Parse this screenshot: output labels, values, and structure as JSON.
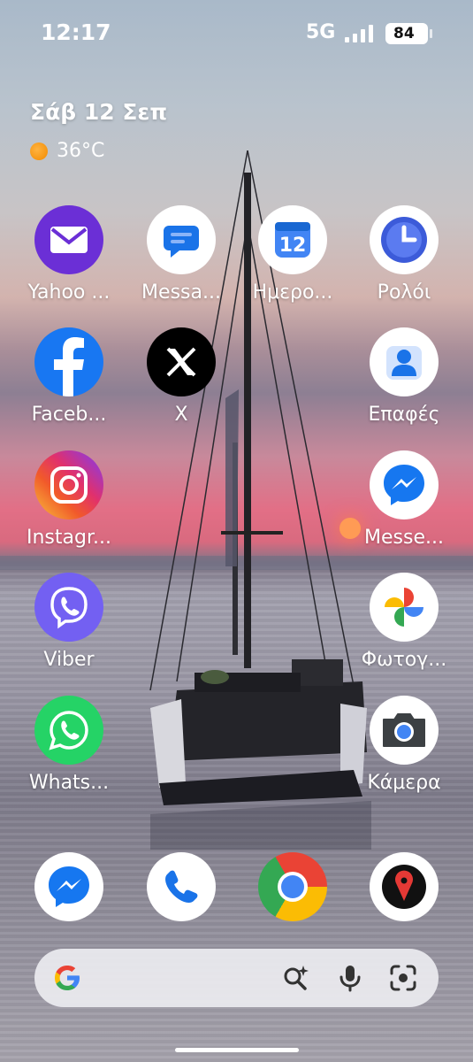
{
  "status": {
    "time": "12:17",
    "network": "5G",
    "battery": "84"
  },
  "widget": {
    "date": "Σάβ 12 Σεπ",
    "temperature": "36°C"
  },
  "apps": [
    {
      "label": "Yahoo ...",
      "icon": "yahoo-mail-icon"
    },
    {
      "label": "Messa...",
      "icon": "messages-icon"
    },
    {
      "label": "Ημερο...",
      "icon": "calendar-icon",
      "day": "12"
    },
    {
      "label": "Ρολόι",
      "icon": "clock-icon"
    },
    {
      "label": "Faceb...",
      "icon": "facebook-icon"
    },
    {
      "label": "X",
      "icon": "x-icon"
    },
    {
      "label": "Επαφές",
      "icon": "contacts-icon"
    },
    {
      "label": "Instagr...",
      "icon": "instagram-icon"
    },
    {
      "label": "Messe...",
      "icon": "messenger-icon"
    },
    {
      "label": "Viber",
      "icon": "viber-icon"
    },
    {
      "label": "Φωτογ...",
      "icon": "photos-icon"
    },
    {
      "label": "Whats...",
      "icon": "whatsapp-icon"
    },
    {
      "label": "Κάμερα",
      "icon": "camera-icon"
    }
  ],
  "dock": [
    {
      "icon": "messenger-icon"
    },
    {
      "icon": "phone-icon"
    },
    {
      "icon": "chrome-icon"
    },
    {
      "icon": "maps-pin-icon"
    }
  ],
  "search_bar": {
    "icons": [
      "google-g-icon",
      "ai-search-icon",
      "mic-icon",
      "lens-icon"
    ]
  }
}
